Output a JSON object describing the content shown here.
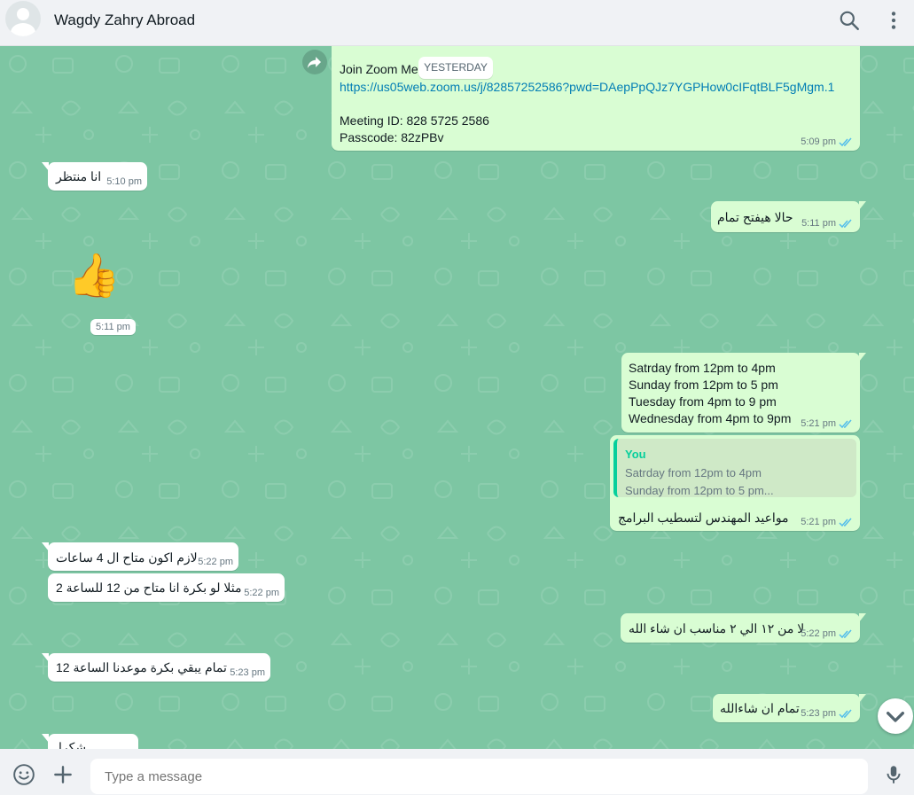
{
  "header": {
    "contact_name": "Wagdy Zahry Abroad",
    "icons": [
      "search-icon",
      "menu-icon"
    ]
  },
  "date_chip": "YESTERDAY",
  "messages": {
    "zoom": {
      "line1": "Join Zoom Me",
      "link": "https://us05web.zoom.us/j/82857252586?pwd=DAepPpQJz7YGPHow0cIFqtBLF5gMgm.1",
      "meeting_id": "Meeting ID: 828 5725 2586",
      "passcode": "Passcode: 82zPBv",
      "time": "5:09 pm"
    },
    "m1": {
      "text": "انا منتظر",
      "time": "5:10 pm"
    },
    "m2": {
      "text": "حالا هيفتح تمام",
      "time": "5:11 pm"
    },
    "m3": {
      "emoji": "👍",
      "time": "5:11 pm"
    },
    "m4": {
      "lines": [
        "Satrday from 12pm to 4pm",
        "Sunday from 12pm to 5 pm",
        "Tuesday from 4pm to 9 pm",
        "Wednesday from 4pm to 9pm"
      ],
      "time": "5:21 pm"
    },
    "m5": {
      "quote_author": "You",
      "quote_line1": "Satrday from 12pm to 4pm",
      "quote_line2": "Sunday from 12pm to 5 pm...",
      "text": "مواعيد  المهندس لتسطيب  البرامج",
      "time": "5:21 pm"
    },
    "m6": {
      "text": "لازم اكون متاح ال 4 ساعات",
      "time": "5:22 pm"
    },
    "m7": {
      "text": "مثلا لو بكرة انا متاح من 12 للساعة 2",
      "time": "5:22 pm"
    },
    "m8": {
      "text": "لا من ١٢ الي ٢ مناسب ان شاء الله",
      "time": "5:22 pm"
    },
    "m9": {
      "text": "تمام يبقي بكرة موعدنا الساعة 12",
      "time": "5:23 pm"
    },
    "m10": {
      "text": "تمام ان شاءالله",
      "time": "5:23 pm"
    },
    "m11": {
      "text": "شكرا"
    }
  },
  "footer": {
    "placeholder": "Type a message",
    "icons": [
      "emoji-icon",
      "attach-icon",
      "mic-icon"
    ]
  },
  "colors": {
    "chat_bg": "#7dc6a3",
    "outgoing": "#d9fdd3",
    "incoming": "#ffffff",
    "read_tick": "#53bdeb",
    "link": "#027eb5"
  }
}
